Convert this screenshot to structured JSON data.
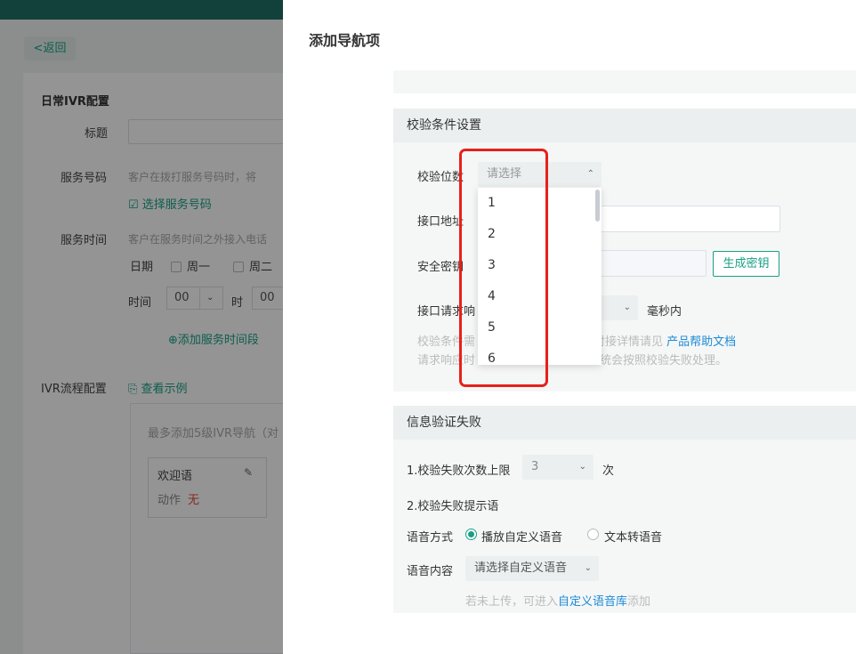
{
  "background": {
    "back_label": "<返回",
    "section_title": "日常IVR配置",
    "title_label": "标题",
    "service_number_label": "服务号码",
    "service_number_hint": "客户在拨打服务号码时，将",
    "select_service_number": "选择服务号码",
    "service_time_label": "服务时间",
    "service_time_hint": "客户在服务时间之外接入电话",
    "date_label": "日期",
    "weekday_mon": "周一",
    "weekday_tue": "周二",
    "time_label": "时间",
    "hour_value": "00",
    "hour_unit": "时",
    "minute_value": "00",
    "add_time_slot": "添加服务时间段",
    "ivr_flow_label": "IVR流程配置",
    "view_example": "查看示例",
    "flow_hint": "最多添加5级IVR导航（对",
    "welcome_title": "欢迎语",
    "action_label": "动作",
    "action_value": "无"
  },
  "drawer": {
    "title": "添加导航项",
    "verify_section_title": "校验条件设置",
    "digits_label": "校验位数",
    "digits_placeholder": "请选择",
    "api_label": "接口地址",
    "secret_label": "安全密钥",
    "generate_key_button": "生成密钥",
    "timeout_label": "接口请求响",
    "timeout_unit": "毫秒内",
    "help_line1_prefix": "校验条件需",
    "help_line1_mid": "，对接详情请见",
    "help_link": "产品帮助文档",
    "help_line2_prefix": "请求响应时",
    "help_line2_suffix": "统会按照校验失败处理。",
    "fail_section_title": "信息验证失败",
    "max_fail_label": "1.校验失败次数上限",
    "max_fail_value": "3",
    "max_fail_unit": "次",
    "fail_prompt_label": "2.校验失败提示语",
    "voice_mode_label": "语音方式",
    "voice_mode_custom": "播放自定义语音",
    "voice_mode_tts": "文本转语音",
    "voice_content_label": "语音内容",
    "voice_content_placeholder": "请选择自定义语音",
    "upload_hint_prefix": "若未上传，可进入",
    "upload_hint_link": "自定义语音库",
    "upload_hint_suffix": "添加"
  },
  "dropdown": {
    "options": [
      "1",
      "2",
      "3",
      "4",
      "5",
      "6"
    ]
  },
  "colors": {
    "accent": "#16a085",
    "link": "#1d8bd6",
    "highlight": "#e8201a",
    "topbar": "#1f6f65"
  }
}
